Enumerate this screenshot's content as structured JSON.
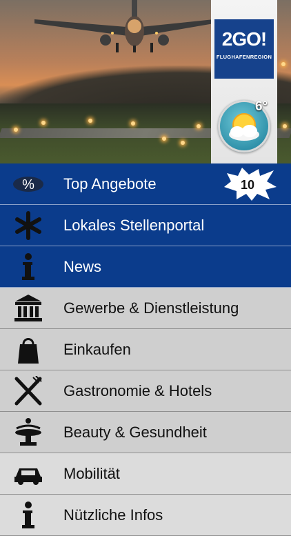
{
  "header": {
    "logo_main": "2GO!",
    "logo_sub": "FLUGHAFENREGION",
    "temperature": "6°",
    "weather_icon": "sun-cloud-icon"
  },
  "menu": {
    "items": [
      {
        "label": "Top Angebote",
        "icon": "percent-icon",
        "badge": "10"
      },
      {
        "label": "Lokales Stellenportal",
        "icon": "asterisk-icon"
      },
      {
        "label": "News",
        "icon": "info-icon"
      },
      {
        "label": "Gewerbe & Dienstleistung",
        "icon": "building-icon"
      },
      {
        "label": "Einkaufen",
        "icon": "shopping-bag-icon"
      },
      {
        "label": "Gastronomie & Hotels",
        "icon": "fork-knife-icon"
      },
      {
        "label": "Beauty & Gesundheit",
        "icon": "fountain-icon"
      },
      {
        "label": "Mobilität",
        "icon": "car-icon"
      },
      {
        "label": "Nützliche Infos",
        "icon": "info-icon"
      }
    ]
  },
  "colors": {
    "blue_item": "#0b3c8c",
    "grey_item": "#cfcfcf",
    "logo_bg": "#16428c"
  }
}
